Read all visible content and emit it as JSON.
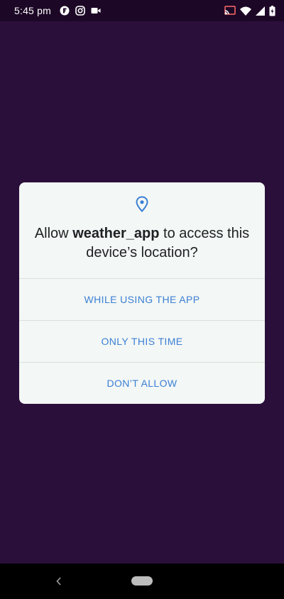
{
  "status_bar": {
    "time": "5:45 pm",
    "left_icons": [
      "fb-icon",
      "instagram-icon",
      "video-camera-icon"
    ],
    "right_icons": [
      "cast-icon",
      "wifi-icon",
      "signal-icon",
      "battery-icon"
    ]
  },
  "dialog": {
    "icon": "location-pin-icon",
    "title_prefix": "Allow ",
    "app_name": "weather_app",
    "title_suffix": " to access this device’s location?",
    "options": [
      {
        "label": "WHILE USING THE APP"
      },
      {
        "label": "ONLY THIS TIME"
      },
      {
        "label": "DON’T ALLOW"
      }
    ]
  },
  "nav_bar": {
    "icons": [
      "back-icon",
      "home-pill-icon"
    ]
  },
  "colors": {
    "backdrop": "#2b0f3b",
    "dialog_bg": "#f3f7f5",
    "accent": "#3b7fd4",
    "text": "#202124"
  }
}
